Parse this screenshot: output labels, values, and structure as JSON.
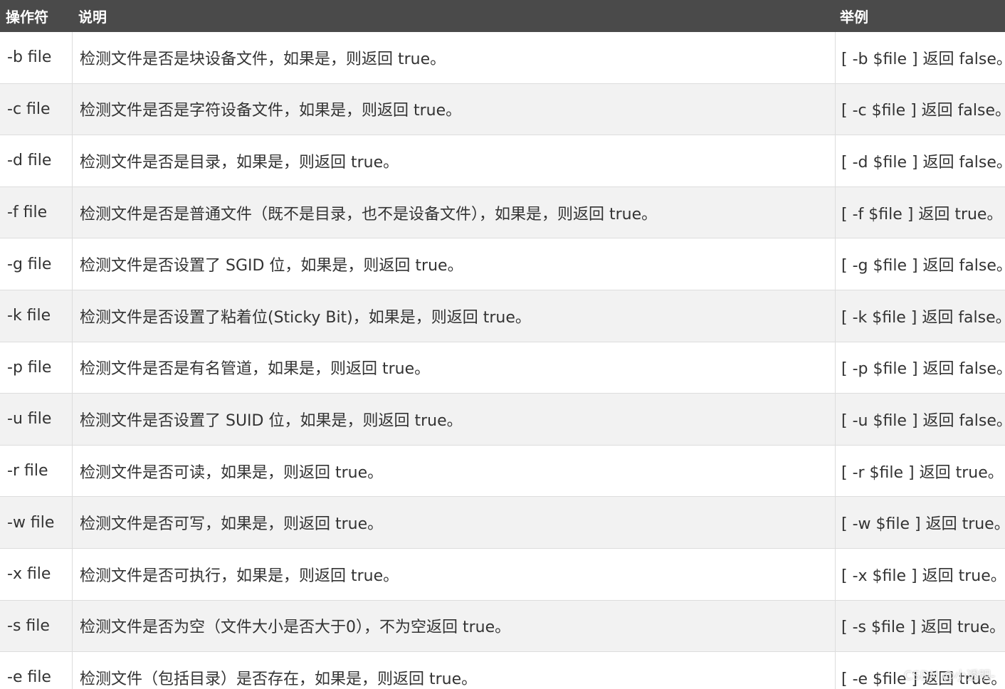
{
  "header": {
    "operator": "操作符",
    "description": "说明",
    "example": "举例"
  },
  "rows": [
    {
      "op": "-b file",
      "desc": "检测文件是否是块设备文件，如果是，则返回 true。",
      "ex": "[ -b $file ] 返回 false。"
    },
    {
      "op": "-c file",
      "desc": "检测文件是否是字符设备文件，如果是，则返回 true。",
      "ex": "[ -c $file ] 返回 false。"
    },
    {
      "op": "-d file",
      "desc": "检测文件是否是目录，如果是，则返回 true。",
      "ex": "[ -d $file ] 返回 false。"
    },
    {
      "op": "-f file",
      "desc": "检测文件是否是普通文件（既不是目录，也不是设备文件），如果是，则返回 true。",
      "ex": "[ -f $file ] 返回 true。"
    },
    {
      "op": "-g file",
      "desc": "检测文件是否设置了 SGID 位，如果是，则返回 true。",
      "ex": "[ -g $file ] 返回 false。"
    },
    {
      "op": "-k file",
      "desc": "检测文件是否设置了粘着位(Sticky Bit)，如果是，则返回 true。",
      "ex": "[ -k $file ] 返回 false。"
    },
    {
      "op": "-p file",
      "desc": "检测文件是否是有名管道，如果是，则返回 true。",
      "ex": "[ -p $file ] 返回 false。"
    },
    {
      "op": "-u file",
      "desc": "检测文件是否设置了 SUID 位，如果是，则返回 true。",
      "ex": "[ -u $file ] 返回 false。"
    },
    {
      "op": "-r file",
      "desc": "检测文件是否可读，如果是，则返回 true。",
      "ex": "[ -r $file ] 返回 true。"
    },
    {
      "op": "-w file",
      "desc": "检测文件是否可写，如果是，则返回 true。",
      "ex": "[ -w $file ] 返回 true。"
    },
    {
      "op": "-x file",
      "desc": "检测文件是否可执行，如果是，则返回 true。",
      "ex": "[ -x $file ] 返回 true。"
    },
    {
      "op": "-s file",
      "desc": "检测文件是否为空（文件大小是否大于0），不为空返回 true。",
      "ex": "[ -s $file ] 返回 true。"
    },
    {
      "op": "-e file",
      "desc": "检测文件（包括目录）是否存在，如果是，则返回 true。",
      "ex": "[ -e $file ] 返回 true。"
    }
  ],
  "watermark": "CSDN @小透明-"
}
